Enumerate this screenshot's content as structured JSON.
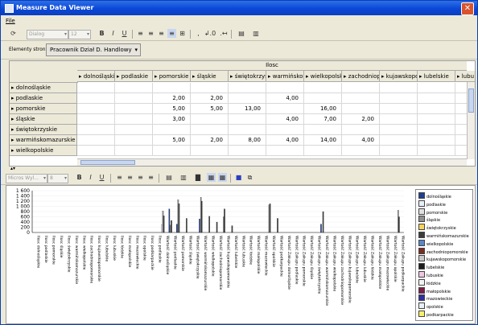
{
  "window": {
    "title": "Measure Data Viewer",
    "close_label": "✕"
  },
  "menu": {
    "file_label": "File"
  },
  "toolbar1": {
    "font_placeholder": "Dialog",
    "size_placeholder": "12",
    "bold": "B",
    "italic": "I",
    "underline": "U",
    "decimals": "↲.0",
    "extra": ".↤"
  },
  "pagebar": {
    "label": "Elementy strony",
    "filter_value": "Pracownik Dział D. Handlowy"
  },
  "grid": {
    "measure_label": "Ilosc",
    "columns": [
      "dolnośląskie",
      "podlaskie",
      "pomorskie",
      "śląskie",
      "świętokrzyskie",
      "warmińskomazurskie",
      "wielkopolskie",
      "zachodniopomorskie",
      "kujawskopomorskie",
      "lubelskie",
      "lubu"
    ],
    "rows": [
      {
        "label": "dolnośląskie",
        "cells": [
          "",
          "",
          "",
          "",
          "",
          "",
          "",
          "",
          "",
          "",
          ""
        ]
      },
      {
        "label": "podlaskie",
        "cells": [
          "",
          "",
          "2,00",
          "2,00",
          "",
          "4,00",
          "",
          "",
          "",
          "",
          ""
        ]
      },
      {
        "label": "pomorskie",
        "cells": [
          "",
          "",
          "5,00",
          "5,00",
          "13,00",
          "",
          "16,00",
          "",
          "",
          "",
          ""
        ]
      },
      {
        "label": "śląskie",
        "cells": [
          "",
          "",
          "3,00",
          "",
          "",
          "4,00",
          "7,00",
          "2,00",
          "",
          "",
          ""
        ]
      },
      {
        "label": "świętokrzyskie",
        "cells": [
          "",
          "",
          "",
          "",
          "",
          "",
          "",
          "",
          "",
          "",
          ""
        ]
      },
      {
        "label": "warmińskomazurskie",
        "cells": [
          "",
          "",
          "5,00",
          "2,00",
          "8,00",
          "4,00",
          "14,00",
          "4,00",
          "",
          "",
          ""
        ]
      },
      {
        "label": "wielkopolskie",
        "cells": [
          "",
          "",
          "",
          "",
          "",
          "",
          "",
          "",
          "",
          "",
          ""
        ]
      }
    ]
  },
  "toolbar2": {
    "font_placeholder": "Micros Wyl...",
    "size_placeholder": "8",
    "bold": "B",
    "italic": "I",
    "underline": "U"
  },
  "chart_data": {
    "type": "bar",
    "ylim": [
      0,
      1600
    ],
    "yticks": [
      "1 600",
      "1 400",
      "1 200",
      "1 000",
      "800",
      "600",
      "400",
      "200",
      "0"
    ],
    "categories": [
      "Ilosc dolnośląskie",
      "Ilosc podlaskie",
      "Ilosc pomorskie",
      "Ilosc śląskie",
      "Ilosc świętokrzyskie",
      "Ilosc warmińskomazurskie",
      "Ilosc wielkopolskie",
      "Ilosc zachodniopomorskie",
      "Ilosc kujawskopomorskie",
      "Ilosc lubelskie",
      "Ilosc lubuskie",
      "Ilosc łódzkie",
      "Ilosc małopolskie",
      "Ilosc mazowieckie",
      "Ilosc opolskie",
      "Ilosc podkarpackie",
      "Ilosc podlaskie",
      "Wartość dolnośląskie",
      "Wartość podlaskie",
      "Wartość pomorskie",
      "Wartość śląskie",
      "Wartość świętokrzyskie",
      "Wartość warmińskomazurskie",
      "Wartość wielkopolskie",
      "Wartość zachodniopomorskie",
      "Wartość kujawskopomorskie",
      "Wartość lubelskie",
      "Wartość lubuskie",
      "Wartość łódzkie",
      "Wartość małopolskie",
      "Wartość mazowieckie",
      "Wartość opolskie",
      "Wartość podkarpackie",
      "Wartość Zakupu dolnośląskie",
      "Wartość Zakupu podlaskie",
      "Wartość Zakupu pomorskie",
      "Wartość Zakupu śląskie",
      "Wartość Zakupu świętokrzyskie",
      "Wartość Zakupu warmińskomazurskie",
      "Wartość Zakupu wielkopolskie",
      "Wartość Zakupu zachodniopomorskie",
      "Wartość Zakupu kujawskopomorskie",
      "Wartość Zakupu lubelskie",
      "Wartość Zakupu lubuskie",
      "Wartość Zakupu łódzkie",
      "Wartość Zakupu małopolskie",
      "Wartość Zakupu mazowieckie",
      "Wartość Zakupu opolskie",
      "Wartość Zakupu podkarpackie"
    ],
    "series": [
      {
        "name": "dolnośląskie",
        "color": "#1f3f8f",
        "values": [
          0,
          0,
          0,
          0,
          0,
          0,
          0,
          0,
          0,
          0,
          0,
          0,
          0,
          0,
          0,
          0,
          0,
          0,
          900,
          320,
          0,
          0,
          520,
          0,
          0,
          0,
          0,
          0,
          0,
          0,
          0,
          0,
          0,
          0,
          0,
          0,
          0,
          0,
          320,
          0,
          0,
          0,
          0,
          0,
          0,
          0,
          0,
          0,
          0
        ]
      },
      {
        "name": "podlaskie",
        "color": "#e8eefc",
        "values": [
          0,
          0,
          0,
          0,
          0,
          0,
          0,
          0,
          0,
          0,
          0,
          0,
          0,
          0,
          0,
          0,
          0,
          300,
          0,
          0,
          0,
          0,
          0,
          0,
          0,
          0,
          0,
          0,
          0,
          0,
          0,
          0,
          0,
          0,
          0,
          0,
          0,
          0,
          0,
          0,
          0,
          0,
          0,
          0,
          0,
          0,
          0,
          0,
          0
        ]
      },
      {
        "name": "pomorskie",
        "color": "#e0e0e0",
        "values": [
          0,
          0,
          0,
          0,
          0,
          0,
          0,
          0,
          0,
          0,
          0,
          0,
          0,
          0,
          0,
          0,
          0,
          0,
          0,
          0,
          0,
          0,
          0,
          0,
          0,
          0,
          0,
          0,
          0,
          0,
          0,
          0,
          0,
          0,
          0,
          0,
          0,
          0,
          0,
          0,
          0,
          0,
          0,
          0,
          0,
          0,
          0,
          0,
          0
        ]
      },
      {
        "name": "śląskie",
        "color": "#8f8f8f",
        "values": [
          0,
          0,
          0,
          0,
          0,
          0,
          0,
          0,
          0,
          0,
          0,
          0,
          0,
          0,
          0,
          0,
          0,
          820,
          280,
          1250,
          0,
          0,
          1350,
          0,
          0,
          600,
          0,
          0,
          0,
          0,
          0,
          1050,
          0,
          0,
          0,
          0,
          0,
          0,
          0,
          0,
          0,
          0,
          0,
          0,
          0,
          0,
          0,
          0,
          850
        ]
      },
      {
        "name": "świętokrzyskie",
        "color": "#f5d45c",
        "values": [
          0,
          0,
          0,
          0,
          0,
          0,
          0,
          0,
          0,
          0,
          0,
          0,
          0,
          0,
          0,
          0,
          0,
          0,
          0,
          0,
          0,
          0,
          0,
          0,
          0,
          0,
          0,
          0,
          0,
          0,
          0,
          0,
          0,
          0,
          0,
          0,
          0,
          0,
          0,
          0,
          0,
          0,
          0,
          0,
          0,
          0,
          0,
          0,
          0
        ]
      },
      {
        "name": "warmińskomazurskie",
        "color": "#3c3c3c",
        "values": [
          0,
          0,
          0,
          0,
          0,
          0,
          0,
          0,
          0,
          0,
          0,
          0,
          0,
          0,
          0,
          0,
          0,
          640,
          460,
          1100,
          540,
          0,
          1200,
          620,
          400,
          900,
          260,
          0,
          0,
          0,
          0,
          1100,
          540,
          0,
          0,
          0,
          0,
          0,
          800,
          0,
          0,
          0,
          0,
          0,
          0,
          0,
          0,
          0,
          600
        ]
      },
      {
        "name": "wielkopolskie",
        "color": "#5c86c7",
        "values": [
          0,
          0,
          0,
          0,
          0,
          0,
          0,
          0,
          0,
          0,
          0,
          0,
          0,
          0,
          0,
          0,
          0,
          0,
          0,
          0,
          0,
          0,
          0,
          0,
          0,
          0,
          0,
          0,
          0,
          0,
          0,
          0,
          0,
          0,
          0,
          0,
          0,
          0,
          0,
          0,
          0,
          0,
          0,
          0,
          0,
          0,
          0,
          0,
          0
        ]
      },
      {
        "name": "zachodniopomorskie",
        "color": "#7a2c22",
        "values": [
          0,
          0,
          0,
          0,
          0,
          0,
          0,
          0,
          0,
          0,
          0,
          0,
          0,
          0,
          0,
          0,
          0,
          0,
          0,
          0,
          0,
          0,
          0,
          0,
          0,
          0,
          0,
          0,
          0,
          0,
          0,
          0,
          0,
          0,
          0,
          0,
          0,
          0,
          0,
          0,
          0,
          0,
          0,
          0,
          0,
          0,
          0,
          0,
          0
        ]
      },
      {
        "name": "kujawskopomorskie",
        "color": "#c9c9c9",
        "values": [
          0,
          0,
          0,
          0,
          0,
          0,
          0,
          0,
          0,
          0,
          0,
          0,
          0,
          0,
          0,
          0,
          0,
          0,
          0,
          0,
          0,
          0,
          0,
          0,
          0,
          0,
          0,
          0,
          0,
          0,
          0,
          0,
          0,
          0,
          0,
          0,
          0,
          0,
          0,
          0,
          0,
          0,
          0,
          0,
          0,
          0,
          0,
          0,
          0
        ]
      },
      {
        "name": "lubelskie",
        "color": "#1c1c1c",
        "values": [
          0,
          0,
          0,
          0,
          0,
          0,
          0,
          0,
          0,
          0,
          0,
          0,
          0,
          0,
          0,
          0,
          0,
          0,
          0,
          0,
          0,
          0,
          0,
          0,
          0,
          0,
          0,
          0,
          0,
          0,
          0,
          0,
          0,
          0,
          0,
          0,
          0,
          0,
          0,
          0,
          0,
          0,
          0,
          0,
          0,
          0,
          0,
          0,
          0
        ]
      },
      {
        "name": "lubuskie",
        "color": "#f0c6e0",
        "values": [
          0,
          0,
          0,
          0,
          0,
          0,
          0,
          0,
          0,
          0,
          0,
          0,
          0,
          0,
          0,
          0,
          0,
          0,
          0,
          0,
          0,
          0,
          0,
          0,
          0,
          0,
          0,
          0,
          0,
          0,
          0,
          0,
          0,
          0,
          0,
          0,
          0,
          0,
          0,
          0,
          0,
          0,
          0,
          0,
          0,
          0,
          0,
          0,
          0
        ]
      },
      {
        "name": "łódzkie",
        "color": "#f3f3f3",
        "values": [
          0,
          0,
          0,
          0,
          0,
          0,
          0,
          0,
          0,
          0,
          0,
          0,
          0,
          0,
          0,
          0,
          0,
          0,
          0,
          0,
          0,
          0,
          0,
          0,
          0,
          0,
          0,
          0,
          0,
          0,
          0,
          0,
          0,
          0,
          0,
          0,
          0,
          0,
          0,
          0,
          0,
          0,
          0,
          0,
          0,
          0,
          0,
          0,
          0
        ]
      },
      {
        "name": "małopolskie",
        "color": "#7b1f48",
        "values": [
          0,
          0,
          0,
          0,
          0,
          0,
          0,
          0,
          0,
          0,
          0,
          0,
          0,
          0,
          0,
          0,
          0,
          0,
          0,
          0,
          0,
          0,
          0,
          0,
          0,
          0,
          0,
          0,
          0,
          0,
          0,
          0,
          0,
          0,
          0,
          0,
          0,
          0,
          0,
          0,
          0,
          0,
          0,
          0,
          0,
          0,
          0,
          0,
          0
        ]
      },
      {
        "name": "mazowieckie",
        "color": "#2f2fa0",
        "values": [
          0,
          0,
          0,
          0,
          0,
          0,
          0,
          0,
          0,
          0,
          0,
          0,
          0,
          0,
          0,
          0,
          0,
          0,
          0,
          0,
          0,
          0,
          0,
          0,
          0,
          0,
          0,
          0,
          0,
          0,
          0,
          0,
          0,
          0,
          0,
          0,
          0,
          0,
          0,
          0,
          0,
          0,
          0,
          0,
          0,
          0,
          0,
          0,
          0
        ]
      },
      {
        "name": "opolskie",
        "color": "#e9f0fb",
        "values": [
          0,
          0,
          0,
          0,
          0,
          0,
          0,
          0,
          0,
          0,
          0,
          0,
          0,
          0,
          0,
          0,
          0,
          0,
          0,
          0,
          0,
          0,
          0,
          0,
          0,
          0,
          0,
          0,
          0,
          0,
          0,
          0,
          0,
          0,
          0,
          0,
          0,
          0,
          0,
          0,
          0,
          0,
          0,
          0,
          0,
          0,
          0,
          0,
          0
        ]
      },
      {
        "name": "podkarpackie",
        "color": "#f7ef6a",
        "values": [
          0,
          0,
          0,
          0,
          0,
          0,
          0,
          0,
          0,
          0,
          0,
          0,
          0,
          0,
          0,
          0,
          0,
          0,
          0,
          0,
          0,
          0,
          0,
          0,
          0,
          0,
          0,
          0,
          0,
          0,
          0,
          0,
          0,
          0,
          0,
          0,
          0,
          0,
          0,
          0,
          0,
          0,
          0,
          0,
          0,
          0,
          0,
          0,
          0
        ]
      }
    ],
    "legend_position": "right"
  }
}
